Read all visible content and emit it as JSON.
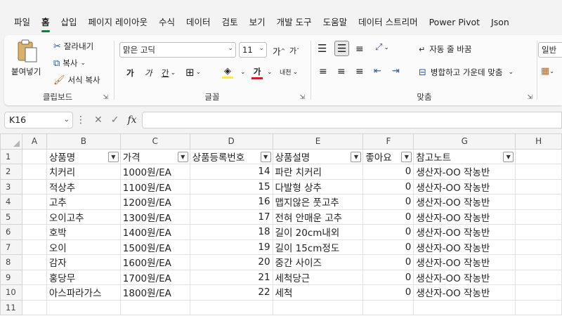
{
  "ribbon_tabs": [
    "파일",
    "홈",
    "삽입",
    "페이지 레이아웃",
    "수식",
    "데이터",
    "검토",
    "보기",
    "개발 도구",
    "도움말",
    "데이터 스트리머",
    "Power Pivot",
    "Json"
  ],
  "active_tab": "홈",
  "clipboard": {
    "paste": "붙여넣기",
    "cut": "잘라내기",
    "copy": "복사",
    "format_painter": "서식 복사",
    "label": "클립보드"
  },
  "font": {
    "name": "맑은 고딕",
    "size": "11",
    "grow": "가",
    "shrink": "가",
    "bold": "가",
    "italic": "가",
    "underline": "간",
    "font_color": "가",
    "phonetic": "내천",
    "label": "글꼴"
  },
  "alignment": {
    "wrap": "자동 줄 바꿈",
    "merge": "병합하고 가운데 맞춤",
    "label": "맞춤"
  },
  "number": {
    "format": "일반"
  },
  "colors": {
    "accent": "#107c41",
    "font_color_bar": "#e81123",
    "fill_color_bar": "#ffeb3b"
  },
  "formula_bar": {
    "name_box": "K16",
    "fx": "fx",
    "value": ""
  },
  "sheet": {
    "columns": [
      "A",
      "B",
      "C",
      "D",
      "E",
      "F",
      "G",
      "H"
    ],
    "rows": [
      "1",
      "2",
      "3",
      "4",
      "5",
      "6",
      "7",
      "8",
      "9",
      "10",
      "11"
    ],
    "headers": [
      "상품명",
      "가격",
      "상품등록번호",
      "상품설명",
      "좋아요",
      "참고노트"
    ],
    "data": [
      [
        "치커리",
        "1000원/EA",
        "14",
        "파란 치커리",
        "0",
        "생산자-OO 작농반"
      ],
      [
        "적상추",
        "1100원/EA",
        "15",
        "다발형 상추",
        "0",
        "생산자-OO 작농반"
      ],
      [
        "고추",
        "1200원/EA",
        "16",
        "맵지않은 풋고추",
        "0",
        "생산자-OO 작농반"
      ],
      [
        "오이고추",
        "1300원/EA",
        "17",
        "전혀 안매운 고추",
        "0",
        "생산자-OO 작농반"
      ],
      [
        "호박",
        "1400원/EA",
        "18",
        "길이 20cm내외",
        "0",
        "생산자-OO 작농반"
      ],
      [
        "오이",
        "1500원/EA",
        "19",
        "길이 15cm정도",
        "0",
        "생산자-OO 작농반"
      ],
      [
        "감자",
        "1600원/EA",
        "20",
        "중간 사이즈",
        "0",
        "생산자-OO 작농반"
      ],
      [
        "홍당무",
        "1700원/EA",
        "21",
        "세척당근",
        "0",
        "생산자-OO 작농반"
      ],
      [
        "아스파라가스",
        "1800원/EA",
        "22",
        "세척",
        "0",
        "생산자-OO 작농반"
      ]
    ]
  }
}
